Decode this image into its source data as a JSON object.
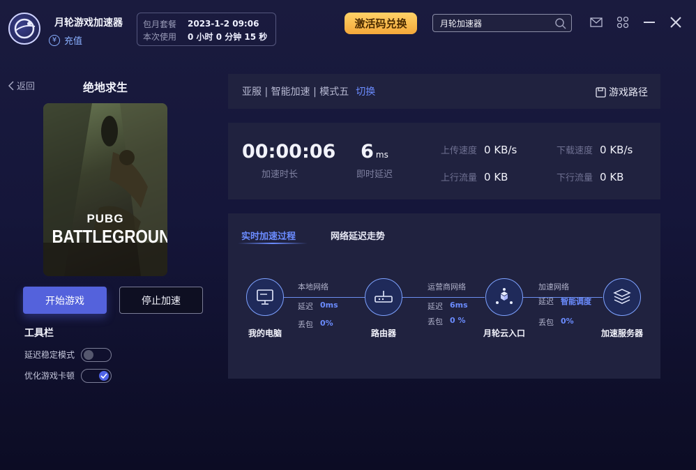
{
  "header": {
    "app_title": "月轮游戏加速器",
    "recharge": "充值",
    "plan_label": "包月套餐",
    "plan_value": "2023-1-2 09:06",
    "usage_label": "本次使用",
    "usage_value": "0 小时 0 分钟 15 秒",
    "redeem_button": "激活码兑换",
    "search_value": "月轮加速器"
  },
  "left": {
    "back": "返回",
    "game_title": "绝地求生",
    "cover_line1": "PUBG",
    "cover_line2": "BATTLEGROUNDS",
    "start_button": "开始游戏",
    "stop_button": "停止加速",
    "toolbar_title": "工具栏",
    "options": [
      {
        "label": "延迟稳定模式",
        "on": false
      },
      {
        "label": "优化游戏卡顿",
        "on": true
      }
    ]
  },
  "route": {
    "summary": "亚服 | 智能加速 | 模式五",
    "switch": "切换",
    "game_path": "游戏路径"
  },
  "stats": {
    "duration_value": "00:00:06",
    "duration_label": "加速时长",
    "latency_value": "6",
    "latency_unit": "ms",
    "latency_label": "即时延迟",
    "upload_speed_label": "上传速度",
    "upload_speed_value": "0 KB/s",
    "download_speed_label": "下载速度",
    "download_speed_value": "0 KB/s",
    "upload_traffic_label": "上行流量",
    "upload_traffic_value": "0 KB",
    "download_traffic_label": "下行流量",
    "download_traffic_value": "0 KB"
  },
  "network": {
    "tabs": [
      "实时加速过程",
      "网络延迟走势"
    ],
    "nodes": [
      "我的电脑",
      "路由器",
      "月轮云入口",
      "加速服务器"
    ],
    "segments": [
      {
        "title": "本地网络",
        "latency_label": "延迟",
        "latency": "0ms",
        "loss_label": "丢包",
        "loss": "0%"
      },
      {
        "title": "运营商网络",
        "latency_label": "延迟",
        "latency": "6ms",
        "loss_label": "丢包",
        "loss": "0 %"
      },
      {
        "title": "加速网络",
        "latency_label": "延迟",
        "latency": "智能调度",
        "loss_label": "丢包",
        "loss": "0%"
      }
    ]
  },
  "icons": [
    "logo-icon",
    "yuan-icon",
    "search-icon",
    "mail-icon",
    "apps-icon",
    "minimize-icon",
    "close-icon",
    "chevron-left-icon",
    "save-icon",
    "monitor-icon",
    "router-icon",
    "cloud-node-icon",
    "server-icon",
    "check-icon"
  ],
  "colors": {
    "accent": "#5462dc",
    "link": "#6b8cff",
    "redeem": "#f4a83a"
  }
}
